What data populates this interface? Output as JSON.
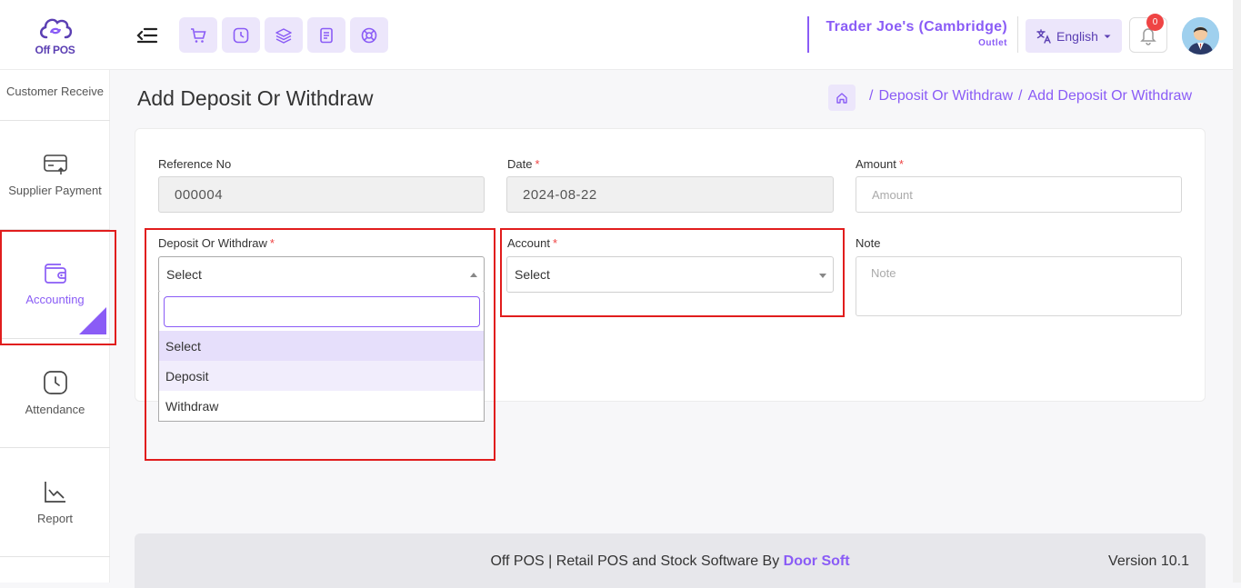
{
  "app": {
    "logo_text": "Off POS"
  },
  "header": {
    "outlet_name": "Trader Joe's (Cambridge)",
    "outlet_sub": "Outlet",
    "language": "English",
    "notification_count": "0"
  },
  "sidebar": {
    "items": [
      {
        "label": "Customer Receive"
      },
      {
        "label": "Supplier Payment"
      },
      {
        "label": "Accounting"
      },
      {
        "label": "Attendance"
      },
      {
        "label": "Report"
      }
    ]
  },
  "page": {
    "title": "Add Deposit Or Withdraw",
    "breadcrumb": [
      "Deposit Or Withdraw",
      "Add Deposit Or Withdraw"
    ],
    "breadcrumb_sep": "/"
  },
  "form": {
    "reference_label": "Reference No",
    "reference_value": "000004",
    "date_label": "Date",
    "date_value": "2024-08-22",
    "amount_label": "Amount",
    "amount_placeholder": "Amount",
    "type_label": "Deposit Or Withdraw",
    "type_selected": "Select",
    "account_label": "Account",
    "account_selected": "Select",
    "note_label": "Note",
    "note_placeholder": "Note",
    "required_mark": "*",
    "type_options": [
      "Select",
      "Deposit",
      "Withdraw"
    ]
  },
  "footer": {
    "text": "Off POS | Retail POS and Stock Software By",
    "brand": "Door Soft",
    "version": "Version 10.1"
  },
  "colors": {
    "accent": "#8a5cf6",
    "accent_light": "#ece6fb",
    "highlight_red": "#e11d1d"
  }
}
